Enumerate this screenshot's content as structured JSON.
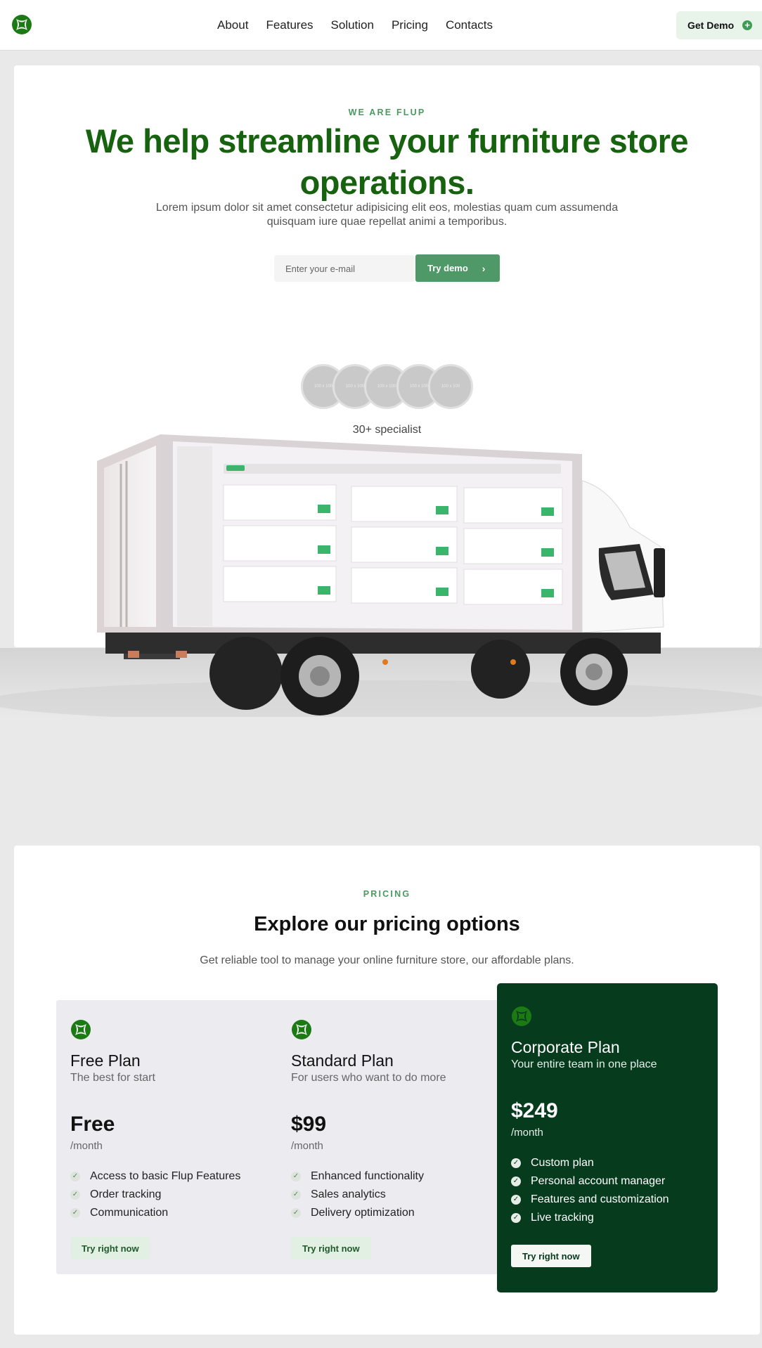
{
  "nav": {
    "links": [
      "About",
      "Features",
      "Solution",
      "Pricing",
      "Contacts"
    ],
    "cta": "Get Demo"
  },
  "hero": {
    "eyebrow": "WE ARE FLUP",
    "title": "We help streamline your furniture store operations.",
    "subtitle": "Lorem ipsum dolor sit amet consectetur adipisicing elit eos, molestias quam cum assumenda quisquam iure quae repellat animi a temporibus.",
    "email_placeholder": "Enter your e-mail",
    "try_demo": "Try demo",
    "avatar_placeholder": "100 x 100",
    "specialists": "30+ specialist"
  },
  "pricing": {
    "eyebrow": "PRICING",
    "title": "Explore our pricing options",
    "subtitle": "Get reliable tool to manage your online furniture store, our affordable plans.",
    "plans": [
      {
        "name": "Free Plan",
        "tagline": "The best for start",
        "price": "Free",
        "period": "/month",
        "features": [
          "Access to basic Flup Features",
          "Order tracking",
          "Communication"
        ],
        "button": "Try right now"
      },
      {
        "name": "Standard Plan",
        "tagline": "For users who want to do more",
        "price": "$99",
        "period": "/month",
        "features": [
          "Enhanced functionality",
          "Sales analytics",
          "Delivery optimization"
        ],
        "button": "Try right now"
      },
      {
        "name": "Corporate Plan",
        "tagline": "Your entire team in one place",
        "price": "$249",
        "period": "/month",
        "features": [
          " Custom plan",
          "Personal account manager",
          "Features and customization",
          "Live tracking"
        ],
        "button": "Try right now"
      }
    ]
  },
  "colors": {
    "brand_green": "#17620f",
    "accent_green": "#4f9868",
    "corporate_bg": "#073b1d"
  }
}
